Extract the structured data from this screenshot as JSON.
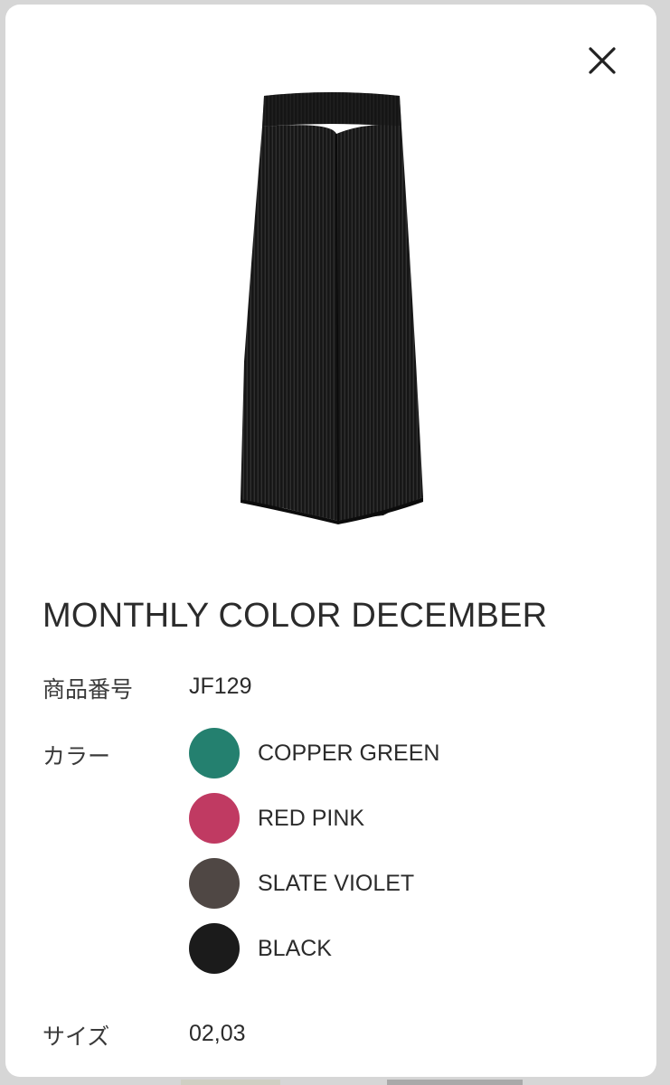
{
  "modal": {
    "close_icon": "close-icon",
    "product_image_icon": "wide-pleated-pants-image"
  },
  "product": {
    "title": "MONTHLY COLOR DECEMBER",
    "number_label": "商品番号",
    "number_value": "JF129",
    "color_label": "カラー",
    "colors": [
      {
        "name": "COPPER GREEN",
        "hex": "#24806f"
      },
      {
        "name": "RED PINK",
        "hex": "#c03a62"
      },
      {
        "name": "SLATE VIOLET",
        "hex": "#4f4744"
      },
      {
        "name": "BLACK",
        "hex": "#1b1b1b"
      }
    ],
    "size_label": "サイズ",
    "size_value": "02,03"
  }
}
